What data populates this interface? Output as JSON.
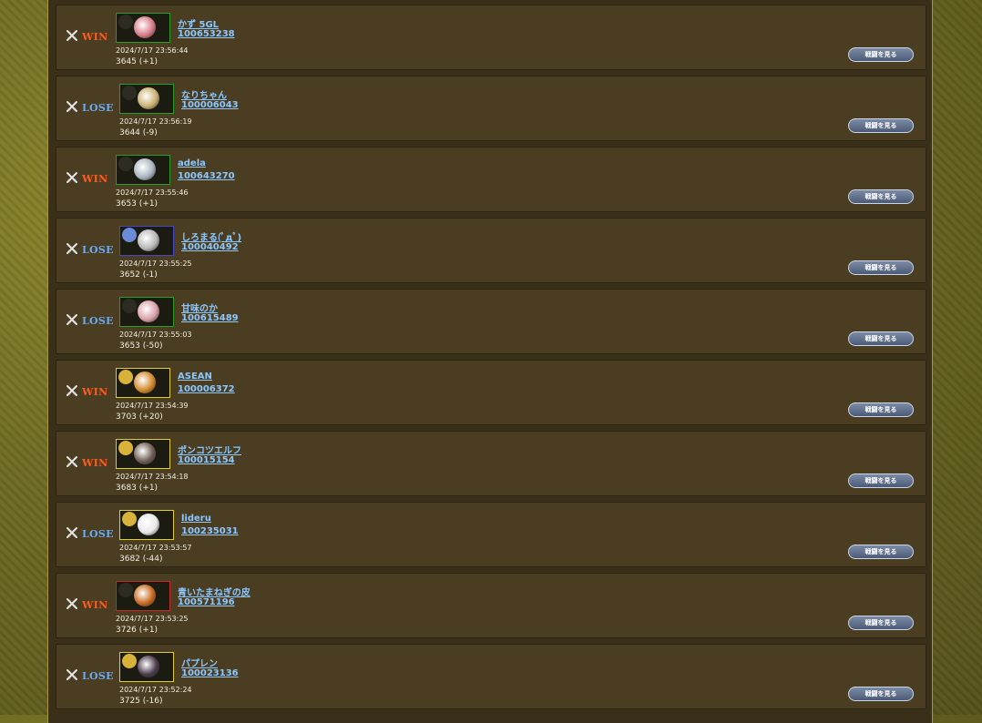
{
  "matches": [
    {
      "result": "WIN",
      "name": "かず 5GL",
      "player_id": "100653238",
      "datetime": "2024/7/17 23:56:44",
      "rating": "3645 (+1)",
      "button": "戦闘を見る",
      "frame": "green"
    },
    {
      "result": "LOSE",
      "name": "なりちゃん",
      "player_id": "100006043",
      "datetime": "2024/7/17 23:56:19",
      "rating": "3644 (-9)",
      "button": "戦闘を見る",
      "frame": "green"
    },
    {
      "result": "WIN",
      "name": "adela",
      "player_id": "100643270",
      "datetime": "2024/7/17 23:55:46",
      "rating": "3653 (+1)",
      "button": "戦闘を見る",
      "frame": "green"
    },
    {
      "result": "LOSE",
      "name": "しろまる(ﾟдﾟ)",
      "player_id": "100040492",
      "datetime": "2024/7/17 23:55:25",
      "rating": "3652 (-1)",
      "button": "戦闘を見る",
      "frame": "blue"
    },
    {
      "result": "LOSE",
      "name": "甘味のか",
      "player_id": "100615489",
      "datetime": "2024/7/17 23:55:03",
      "rating": "3653 (-50)",
      "button": "戦闘を見る",
      "frame": "green"
    },
    {
      "result": "WIN",
      "name": "ASEAN",
      "player_id": "100006372",
      "datetime": "2024/7/17 23:54:39",
      "rating": "3703 (+20)",
      "button": "戦闘を見る",
      "frame": "gold"
    },
    {
      "result": "WIN",
      "name": "ポンコツエルフ",
      "player_id": "100015154",
      "datetime": "2024/7/17 23:54:18",
      "rating": "3683 (+1)",
      "button": "戦闘を見る",
      "frame": "gold"
    },
    {
      "result": "LOSE",
      "name": "lideru",
      "player_id": "100235031",
      "datetime": "2024/7/17 23:53:57",
      "rating": "3682 (-44)",
      "button": "戦闘を見る",
      "frame": "gold"
    },
    {
      "result": "WIN",
      "name": "青いたまねぎの皮",
      "player_id": "100571196",
      "datetime": "2024/7/17 23:53:25",
      "rating": "3726 (+1)",
      "button": "戦闘を見る",
      "frame": "red"
    },
    {
      "result": "LOSE",
      "name": "パプレン",
      "player_id": "100023136",
      "datetime": "2024/7/17 23:52:24",
      "rating": "3725 (-16)",
      "button": "戦闘を見る",
      "frame": "gold"
    }
  ],
  "colors": {
    "win": "#ff5a1f",
    "lose": "#6aaaf0",
    "link": "#8cc8ff",
    "row_bg": "#4a3d22"
  },
  "icons": {
    "result": "crossed-swords-icon",
    "avatar": "player-avatar-icon"
  }
}
